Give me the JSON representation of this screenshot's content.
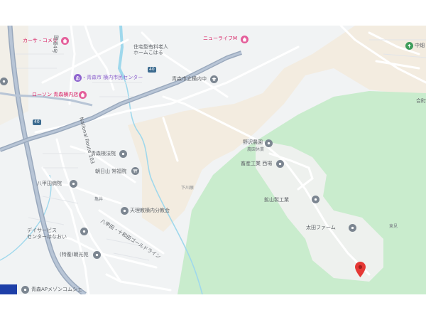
{
  "map": {
    "labels": {
      "karsa_komeri": "カーサ・コメリ",
      "newlife_m": "ニューライフM",
      "jutaku_home": "住宅型有料老人\nホームこはる",
      "aomori_yokouchi_center": "・青森市 横内市民センター",
      "lawson": "ローソン 青森横内店",
      "aomori_yokouchi_chu": "青森市立横内中",
      "aomori_koho_in": "青森検法院",
      "asahiyama": "朝日山 常福院",
      "hakkoda_iryo": "八甲田病院",
      "kamei": "亀井",
      "tenri": "天理教横内分教会",
      "day_service": "デイサービス\nセンターはなおい",
      "tokuyo": "(特養)朝光苑",
      "aomori_ap": "青森APメゾンコムシェ",
      "nozawa_nouen": "野沢農園",
      "nozawa_sub": "農園休業",
      "chikusan": "畜産工業 西場",
      "kozanshi": "鉱山製工業",
      "ota_farm": "太田ファーム",
      "shimokawa": "下川原",
      "shimoku": "東見",
      "nakayama": "中畑",
      "iwakuchi": "合町",
      "route_103": "National Route 103",
      "route_4": "国道4号",
      "hakkoda_line": "八甲田・十和田ゴールドライン",
      "route_badge": "40",
      "route_badge2": "40"
    },
    "icons": {
      "shopping": "shopping-bag-icon",
      "government": "government-building-icon",
      "school": "school-icon",
      "temple": "temple-icon",
      "hospital": "hospital-icon",
      "place": "place-pin-icon",
      "park": "park-icon",
      "marker": "location-marker-icon"
    },
    "colors": {
      "road_major": "#9aa9bd",
      "road_minor": "#ffffff",
      "park": "#d8f0d6",
      "forest": "#c9eccd",
      "sand": "#f3ece0",
      "water": "#9fd8ec",
      "marker": "#e53935"
    }
  }
}
